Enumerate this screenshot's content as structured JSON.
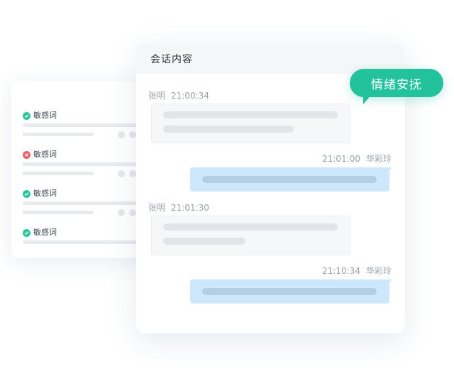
{
  "side_panel": {
    "items": [
      {
        "label": "敏感词",
        "status": "ok",
        "status_icon": "check-circle-icon"
      },
      {
        "label": "敏感词",
        "status": "error",
        "status_icon": "x-circle-icon"
      },
      {
        "label": "敏感词",
        "status": "ok",
        "status_icon": "check-circle-icon"
      },
      {
        "label": "敏感词",
        "status": "ok",
        "status_icon": "check-circle-icon"
      }
    ]
  },
  "dialog": {
    "title": "会话内容",
    "messages": [
      {
        "direction": "incoming",
        "name": "张明",
        "time": "21:00:34"
      },
      {
        "direction": "outgoing",
        "name": "华彩玲",
        "time": "21:01:00"
      },
      {
        "direction": "incoming",
        "name": "张明",
        "time": "21:01:30"
      },
      {
        "direction": "outgoing",
        "name": "华彩玲",
        "time": "21:10:34"
      }
    ]
  },
  "emotion_badge": {
    "label": "情绪安抚"
  },
  "colors": {
    "accent_green": "#22c29c",
    "status_ok": "#2ec4a0",
    "status_error": "#f0606b",
    "outgoing_bubble": "#cde7fc"
  }
}
